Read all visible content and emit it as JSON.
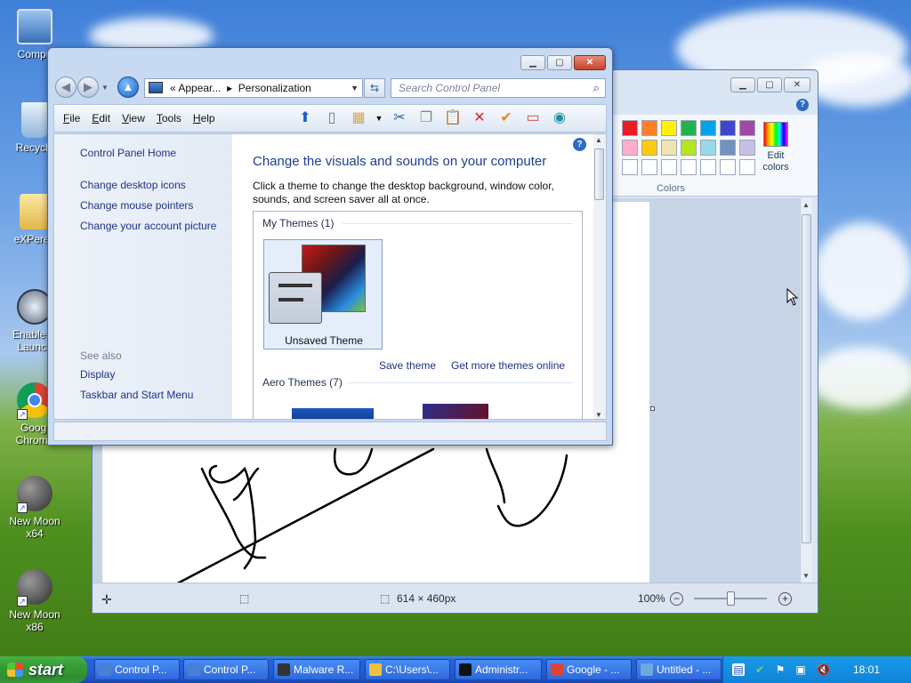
{
  "desktop": {
    "icons": [
      {
        "label": "Compu",
        "icon": "computer-icon"
      },
      {
        "label": "Recycle",
        "icon": "recycle-bin-icon"
      },
      {
        "label": "eXPeren",
        "icon": "folder-icon"
      },
      {
        "label": "Enable Q Launch",
        "icon": "quicklaunch-icon"
      },
      {
        "label": "Googl Chrome",
        "icon": "chrome-icon"
      },
      {
        "label": "New Moon x64",
        "icon": "moon-icon"
      },
      {
        "label": "New Moon x86",
        "icon": "moon-icon"
      }
    ]
  },
  "paint": {
    "colors_label": "Colors",
    "edit_colors_label": "Edit colors",
    "palette": [
      "#ed1c24",
      "#ff7f27",
      "#fff200",
      "#22b14c",
      "#00a2e8",
      "#3f48cc",
      "#a349a4",
      "#ffaec9",
      "#ffc90e",
      "#efe4b0",
      "#b5e61d",
      "#99d9ea",
      "#7092be",
      "#c8bfe7",
      "#ffffff",
      "#ffffff",
      "#ffffff",
      "#ffffff",
      "#ffffff",
      "#ffffff",
      "#ffffff"
    ],
    "status": {
      "size": "614 × 460px",
      "zoom": "100%"
    }
  },
  "control_panel": {
    "address": {
      "prefix": "«",
      "crumb1": "Appear...",
      "separator": "▸",
      "crumb2": "Personalization"
    },
    "search_placeholder": "Search Control Panel",
    "menu": [
      "File",
      "Edit",
      "View",
      "Tools",
      "Help"
    ],
    "left": {
      "home": "Control Panel Home",
      "links": [
        "Change desktop icons",
        "Change mouse pointers",
        "Change your account picture"
      ],
      "see_also": "See also",
      "see_also_links": [
        "Display",
        "Taskbar and Start Menu"
      ]
    },
    "heading": "Change the visuals and sounds on your computer",
    "description": "Click a theme to change the desktop background, window color, sounds, and screen saver all at once.",
    "my_themes_header": "My Themes (1)",
    "unsaved_theme": "Unsaved Theme",
    "save_theme": "Save theme",
    "get_more_themes": "Get more themes online",
    "aero_themes_header": "Aero Themes (7)"
  },
  "taskbar": {
    "start_label": "start",
    "items": [
      {
        "label": "Control P...",
        "color": "#4a7fd6"
      },
      {
        "label": "Control P...",
        "color": "#4a7fd6"
      },
      {
        "label": "Malware R...",
        "color": "#333333"
      },
      {
        "label": "C:\\Users\\...",
        "color": "#f0c040"
      },
      {
        "label": "Administr...",
        "color": "#111111"
      },
      {
        "label": "Google - ...",
        "color": "#db4437"
      },
      {
        "label": "Untitled - ...",
        "color": "#6fa8dc"
      }
    ],
    "clock": "18:01"
  }
}
